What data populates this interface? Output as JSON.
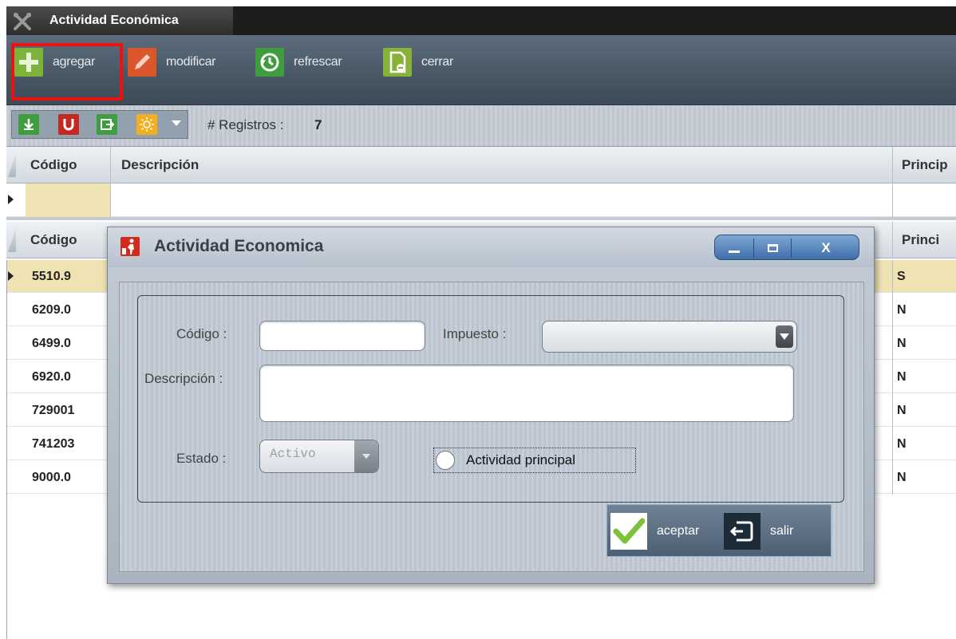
{
  "window": {
    "title": "Actividad Económica"
  },
  "toolbar": {
    "add_label": "agregar",
    "edit_label": "modificar",
    "refresh_label": "refrescar",
    "close_label": "cerrar"
  },
  "records": {
    "label": "# Registros :",
    "count": "7"
  },
  "top_grid": {
    "columns": [
      "Código",
      "Descripción",
      "Princip"
    ]
  },
  "main_grid": {
    "columns": [
      "Código",
      "Princi"
    ],
    "rows": [
      {
        "code": "5510.9",
        "principal": "S",
        "selected": true
      },
      {
        "code": "6209.0",
        "principal": "N"
      },
      {
        "code": "6499.0",
        "principal": "N"
      },
      {
        "code": "6920.0",
        "principal": "N"
      },
      {
        "code": "729001",
        "principal": "N"
      },
      {
        "code": "741203",
        "principal": "N"
      },
      {
        "code": "9000.0",
        "principal": "N"
      }
    ]
  },
  "dialog": {
    "title": "Actividad Economica",
    "codigo_label": "Código :",
    "codigo_value": "",
    "impuesto_label": "Impuesto :",
    "impuesto_value": "",
    "descripcion_label": "Descripción :",
    "descripcion_value": "",
    "estado_label": "Estado :",
    "estado_value": "Activo",
    "principal_label": "Actividad principal",
    "accept_label": "aceptar",
    "exit_label": "salir",
    "minimize_label": "_",
    "close_label": "X"
  },
  "colors": {
    "add": "#7db33a",
    "edit": "#d9572a",
    "refresh": "#3e9d3c",
    "close": "#87b23a",
    "selected_row": "#efe3b4"
  }
}
